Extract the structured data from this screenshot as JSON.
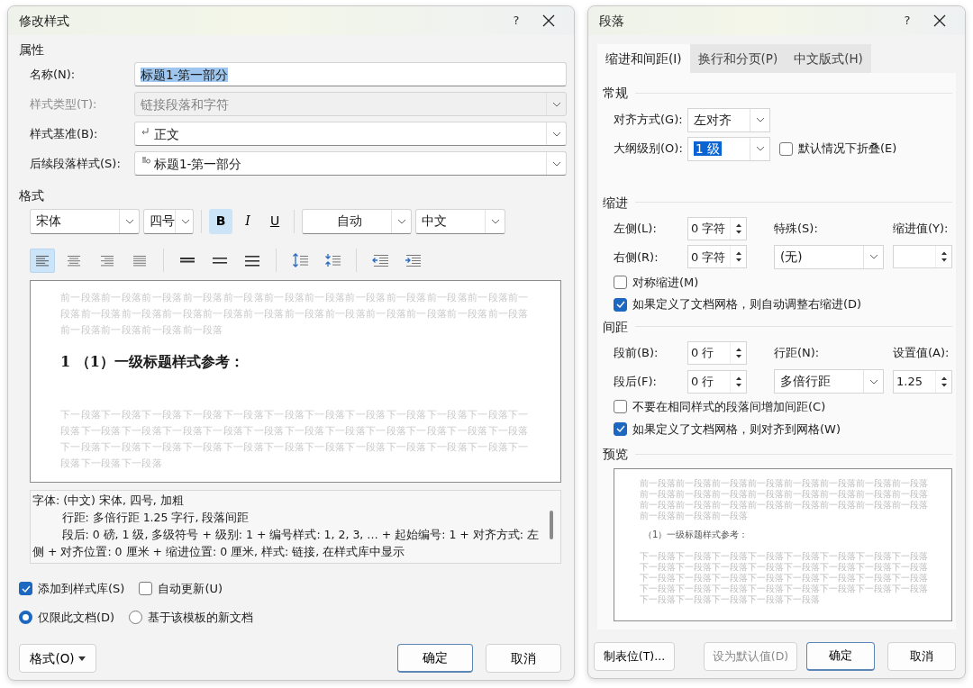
{
  "modify_style_dialog": {
    "title": "修改样式",
    "help": "?",
    "properties": {
      "heading": "属性",
      "fields": [
        {
          "kind": "text",
          "label": "名称(N):",
          "value": "标题1-第一部分",
          "value_selected": true,
          "disabled": false
        },
        {
          "kind": "combo",
          "label": "样式类型(T):",
          "value": "链接段落和字符",
          "disabled": true
        },
        {
          "kind": "combo",
          "label": "样式基准(B):",
          "value": "正文",
          "disabled": false
        },
        {
          "kind": "combo",
          "label": "后续段落样式(S):",
          "value": "标题1-第一部分",
          "disabled": false
        }
      ]
    },
    "format": {
      "heading": "格式",
      "font": "宋体",
      "size": "四号",
      "styles": [
        {
          "kind": "bold",
          "label": "B",
          "selected": true
        },
        {
          "kind": "italic",
          "label": "I",
          "selected": false
        },
        {
          "kind": "underline",
          "label": "U",
          "selected": false
        }
      ],
      "font_color": "自动",
      "language": "中文",
      "tool_groups": [
        [
          {
            "kind": "align-left",
            "selected": true
          },
          {
            "kind": "align-center",
            "selected": false
          },
          {
            "kind": "align-right",
            "selected": false
          },
          {
            "kind": "justify",
            "selected": false
          }
        ],
        [
          {
            "kind": "single-spacing",
            "selected": false
          },
          {
            "kind": "one-half-spacing",
            "selected": false
          },
          {
            "kind": "double-spacing",
            "selected": false
          }
        ],
        [
          {
            "kind": "space-increase",
            "selected": false
          },
          {
            "kind": "space-decrease",
            "selected": false
          }
        ],
        [
          {
            "kind": "indent-decrease",
            "selected": false
          },
          {
            "kind": "indent-increase",
            "selected": false
          }
        ]
      ]
    },
    "preview": {
      "before": "前一段落前一段落前一段落前一段落前一段落前一段落前一段落前一段落前一段落前一段落前一段落前一段落前一段落前一段落前一段落前一段落前一段落前一段落前一段落前一段落前一段落前一段落前一段落前一段落前一段落前一段落前一段落",
      "heading": "1 （1）一级标题样式参考：",
      "after": "下一段落下一段落下一段落下一段落下一段落下一段落下一段落下一段落下一段落下一段落下一段落下一段落下一段落下一段落下一段落下一段落下一段落下一段落下一段落下一段落下一段落下一段落下一段落下一段落下一段落下一段落下一段落下一段落下一段落下一段落下一段落下一段落下一段落下一段落下一段落下一段落下一段落"
    },
    "description": [
      "字体: (中文) 宋体, 四号, 加粗",
      "行距: 多倍行距 1.25 字行, 段落间距",
      "段后: 0 磅, 1 级, 多级符号 + 级别: 1 + 编号样式: 1, 2, 3, … + 起始编号: 1 + 对齐方式: 左侧 + 对齐位置:  0 厘米 + 缩进位置:  0 厘米, 样式: 链接, 在样式库中显示"
    ],
    "options": [
      {
        "label": "添加到样式库(S)",
        "checked": true
      },
      {
        "label": "自动更新(U)",
        "checked": false
      }
    ],
    "scope": [
      {
        "label": "仅限此文档(D)",
        "selected": true
      },
      {
        "label": "基于该模板的新文档",
        "selected": false
      }
    ],
    "buttons": [
      {
        "kind": "menu",
        "label": "格式(O)",
        "default": false
      },
      {
        "kind": "ok",
        "label": "确定",
        "default": true
      },
      {
        "kind": "cancel",
        "label": "取消",
        "default": false
      }
    ]
  },
  "paragraph_dialog": {
    "title": "段落",
    "help": "?",
    "tabs": [
      {
        "label": "缩进和间距(I)",
        "selected": true
      },
      {
        "label": "换行和分页(P)",
        "selected": false
      },
      {
        "label": "中文版式(H)",
        "selected": false
      }
    ],
    "general": {
      "heading": "常规",
      "alignment": {
        "label": "对齐方式(G):",
        "value": "左对齐",
        "value_selected": false
      },
      "outline": {
        "label": "大纲级别(O):",
        "value": "1 级",
        "value_selected": true
      },
      "collapse": {
        "label": "默认情况下折叠(E)",
        "checked": false
      }
    },
    "indent": {
      "heading": "缩进",
      "left": {
        "label": "左侧(L):",
        "value": "0 字符"
      },
      "right": {
        "label": "右侧(R):",
        "value": "0 字符"
      },
      "special": {
        "label": "特殊(S):",
        "value": "(无)"
      },
      "by": {
        "label": "缩进值(Y):"
      },
      "options": [
        {
          "label": "对称缩进(M)",
          "checked": false
        },
        {
          "label": "如果定义了文档网格，则自动调整右缩进(D)",
          "checked": true
        }
      ]
    },
    "spacing": {
      "heading": "间距",
      "before": {
        "label": "段前(B):",
        "value": "0 行"
      },
      "after": {
        "label": "段后(F):",
        "value": "0 行"
      },
      "line": {
        "label": "行距(N):",
        "value": "多倍行距"
      },
      "at": {
        "label": "设置值(A):",
        "value": "1.25"
      },
      "options": [
        {
          "label": "不要在相同样式的段落间增加间距(C)",
          "checked": false
        },
        {
          "label": "如果定义了文档网格，则对齐到网格(W)",
          "checked": true
        }
      ]
    },
    "preview": {
      "heading": "预览",
      "before": "前一段落前一段落前一段落前一段落前一段落前一段落前一段落前一段落前一段落前一段落前一段落前一段落前一段落前一段落前一段落前一段落前一段落前一段落前一段落前一段落前一段落前一段落前一段落前一段落前一段落前一段落前一段落",
      "sample": "（1）一级标题样式参考：",
      "after": "下一段落下一段落下一段落下一段落下一段落下一段落下一段落下一段落下一段落下一段落下一段落下一段落下一段落下一段落下一段落下一段落下一段落下一段落下一段落下一段落下一段落下一段落下一段落下一段落下一段落下一段落下一段落下一段落下一段落下一段落下一段落下一段落下一段落下一段落下一段落下一段落下一段落"
    },
    "buttons": [
      {
        "kind": "tabs",
        "label": "制表位(T)...",
        "disabled": false,
        "default": false
      },
      {
        "kind": "set-default",
        "label": "设为默认值(D)",
        "disabled": true,
        "default": false
      },
      {
        "kind": "ok",
        "label": "确定",
        "disabled": false,
        "default": true
      },
      {
        "kind": "cancel",
        "label": "取消",
        "disabled": false,
        "default": false
      }
    ]
  }
}
